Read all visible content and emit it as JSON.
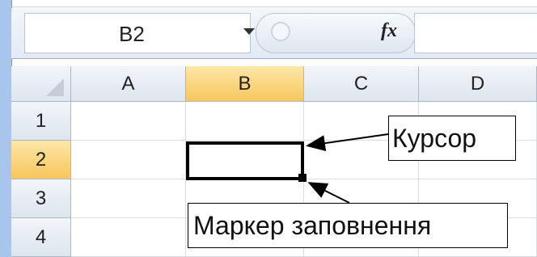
{
  "formula_bar": {
    "name_box_value": "B2",
    "fx_label": "fx",
    "formula_value": ""
  },
  "columns": [
    "A",
    "B",
    "C",
    "D"
  ],
  "rows": [
    "1",
    "2",
    "3",
    "4"
  ],
  "active_cell": {
    "column": "B",
    "row": "2"
  },
  "annotations": {
    "cursor_label": "Курсор",
    "fill_handle_label": "Маркер  заповнення"
  },
  "colors": {
    "active_header": "#f7c65c",
    "header": "#dde5ee",
    "left_bar": "#a8c6ec"
  }
}
